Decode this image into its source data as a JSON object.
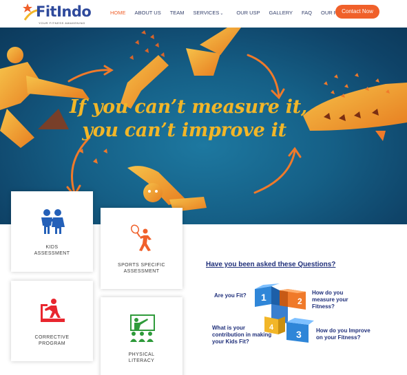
{
  "brand": {
    "name_prefix": "Fit",
    "name_suffix": "Indo",
    "tagline": "YOUR FITNESS AWAKENING"
  },
  "nav": {
    "items": [
      "HOME",
      "ABOUT US",
      "TEAM",
      "SERVICES",
      "OUR USP",
      "GALLERY",
      "FAQ",
      "OUR PARTNERS"
    ],
    "active": "HOME",
    "services_chevron": "⌄",
    "contact_label": "Contact Now"
  },
  "hero": {
    "line1": "If you can’t measure it,",
    "line2": "you can’t improve it"
  },
  "cards": [
    {
      "line1": "KIDS",
      "line2": "ASSESSMENT",
      "icon": "kids-icon"
    },
    {
      "line1": "SPORTS SPECIFIC",
      "line2": "ASSESSMENT",
      "icon": "tennis-player-icon"
    },
    {
      "line1": "CORRECTIVE",
      "line2": "PROGRAM",
      "icon": "treadmill-icon"
    },
    {
      "line1": "PHYSICAL",
      "line2": "LITERACY",
      "icon": "classroom-icon"
    }
  ],
  "questions": {
    "heading": "Have you been asked these Questions?",
    "q1": "Are you Fit?",
    "q2_l1": "How do you",
    "q2_l2": "measure your",
    "q2_l3": "Fitness?",
    "q3_l1": "What is your",
    "q3_l2": "contribution in making",
    "q3_l3": "your Kids Fit?",
    "q4_l1": "How do you Improve",
    "q4_l2": "on your Fitness?",
    "n1": "1",
    "n2": "2",
    "n3": "3",
    "n4": "4"
  },
  "colors": {
    "accent": "#f0602a",
    "navy": "#1f2f7a",
    "hero_text": "#f2b628",
    "hero_bg": "#155f86"
  }
}
